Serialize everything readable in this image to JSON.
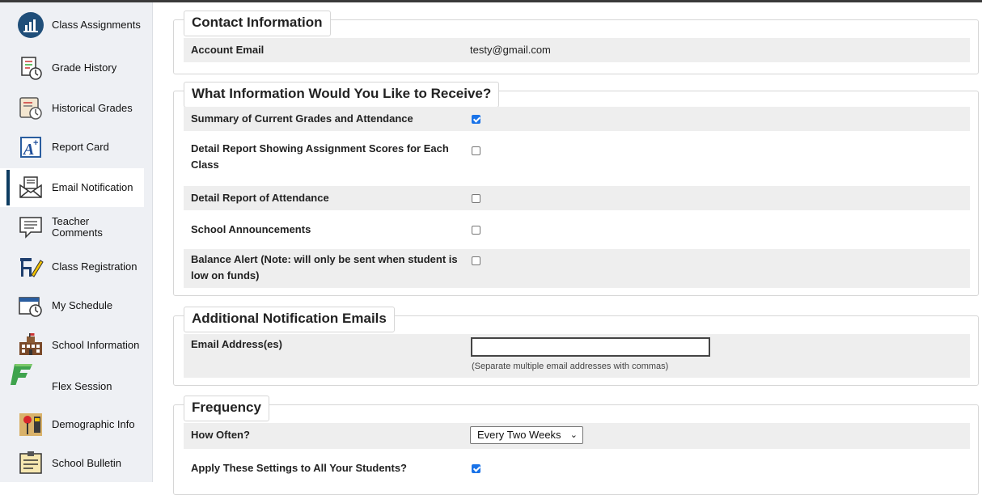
{
  "sidebar": {
    "items": [
      {
        "label": "Class Assignments",
        "icon": "class-assignments-icon"
      },
      {
        "label": "Grade History",
        "icon": "grade-history-icon"
      },
      {
        "label": "Historical Grades",
        "icon": "historical-grades-icon"
      },
      {
        "label": "Report Card",
        "icon": "report-card-icon"
      },
      {
        "label": "Email Notification",
        "icon": "email-notification-icon",
        "active": true
      },
      {
        "label": "Teacher Comments",
        "icon": "teacher-comments-icon"
      },
      {
        "label": "Class Registration",
        "icon": "class-registration-icon"
      },
      {
        "label": "My Schedule",
        "icon": "my-schedule-icon"
      },
      {
        "label": "School Information",
        "icon": "school-information-icon"
      },
      {
        "label": "Flex Session",
        "icon": "flex-session-icon"
      },
      {
        "label": "Demographic Info",
        "icon": "demographic-info-icon"
      },
      {
        "label": "School Bulletin",
        "icon": "school-bulletin-icon"
      }
    ]
  },
  "contact": {
    "title": "Contact Information",
    "account_email_label": "Account Email",
    "account_email_value": "testy@gmail.com"
  },
  "receive": {
    "title": "What Information Would You Like to Receive?",
    "options": [
      {
        "label": "Summary of Current Grades and Attendance",
        "checked": true
      },
      {
        "label": "Detail Report Showing Assignment Scores for Each Class",
        "checked": false
      },
      {
        "label": "Detail Report of Attendance",
        "checked": false
      },
      {
        "label": "School Announcements",
        "checked": false
      },
      {
        "label": "Balance Alert (Note: will only be sent when student is low on funds)",
        "checked": false
      }
    ]
  },
  "additional": {
    "title": "Additional Notification Emails",
    "email_label": "Email Address(es)",
    "email_value": "",
    "hint": "(Separate multiple email addresses with commas)"
  },
  "frequency": {
    "title": "Frequency",
    "how_often_label": "How Often?",
    "how_often_value": "Every Two Weeks",
    "apply_all_label": "Apply These Settings to All Your Students?",
    "apply_all_checked": true
  },
  "colors": {
    "accent": "#0d3c61",
    "checkbox": "#1a73e8",
    "row_shade": "#eeeeee",
    "sidebar_bg": "#eef0f4"
  }
}
